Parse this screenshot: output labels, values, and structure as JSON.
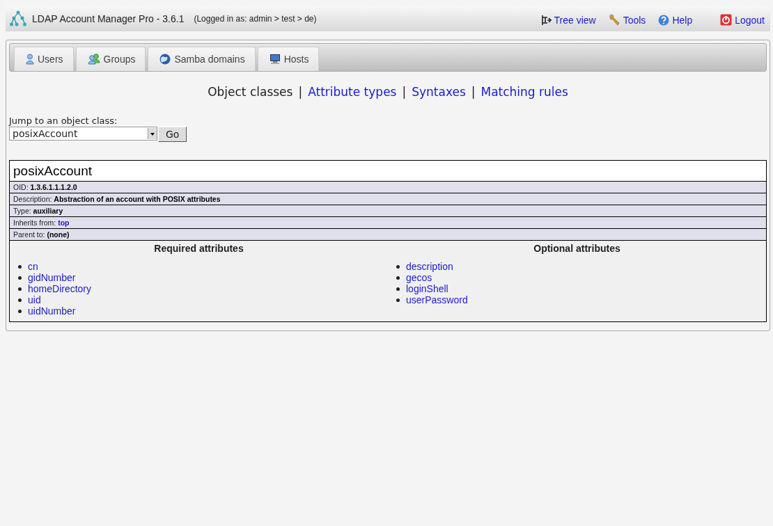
{
  "header": {
    "title": "LDAP Account Manager Pro - 3.6.1",
    "login_info": "(Logged in as: admin > test > de)",
    "links": [
      {
        "kind": "tree",
        "label": "Tree view"
      },
      {
        "kind": "tools",
        "label": "Tools"
      },
      {
        "kind": "help",
        "label": "Help"
      },
      {
        "kind": "logout",
        "label": "Logout"
      }
    ]
  },
  "tabs": [
    {
      "kind": "users",
      "label": "Users",
      "selected": false
    },
    {
      "kind": "groups",
      "label": "Groups",
      "selected": false
    },
    {
      "kind": "samba",
      "label": "Samba domains",
      "selected": false
    },
    {
      "kind": "hosts",
      "label": "Hosts",
      "selected": false
    }
  ],
  "schema_nav": [
    {
      "label": "Object classes",
      "selected": true
    },
    {
      "label": "Attribute types",
      "selected": false
    },
    {
      "label": "Syntaxes",
      "selected": false
    },
    {
      "label": "Matching rules",
      "selected": false
    }
  ],
  "separator": "|",
  "jump": {
    "label": "Jump to an object class:",
    "value": "posixAccount",
    "button": "Go"
  },
  "object_class": {
    "name": "posixAccount",
    "properties": [
      {
        "label": "OID:",
        "value": "1.3.6.1.1.1.2.0",
        "kind": "text"
      },
      {
        "label": "Description:",
        "value": "Abstraction of an account with POSIX attributes",
        "kind": "text"
      },
      {
        "label": "Type:",
        "value": "auxiliary",
        "kind": "text"
      },
      {
        "label": "Inherits from:",
        "value": "top",
        "kind": "link"
      },
      {
        "label": "Parent to:",
        "value": "(none)",
        "kind": "text"
      }
    ],
    "required_heading": "Required attributes",
    "required": [
      "cn",
      "gidNumber",
      "homeDirectory",
      "uid",
      "uidNumber"
    ],
    "optional_heading": "Optional attributes",
    "optional": [
      "description",
      "gecos",
      "loginShell",
      "userPassword"
    ]
  }
}
